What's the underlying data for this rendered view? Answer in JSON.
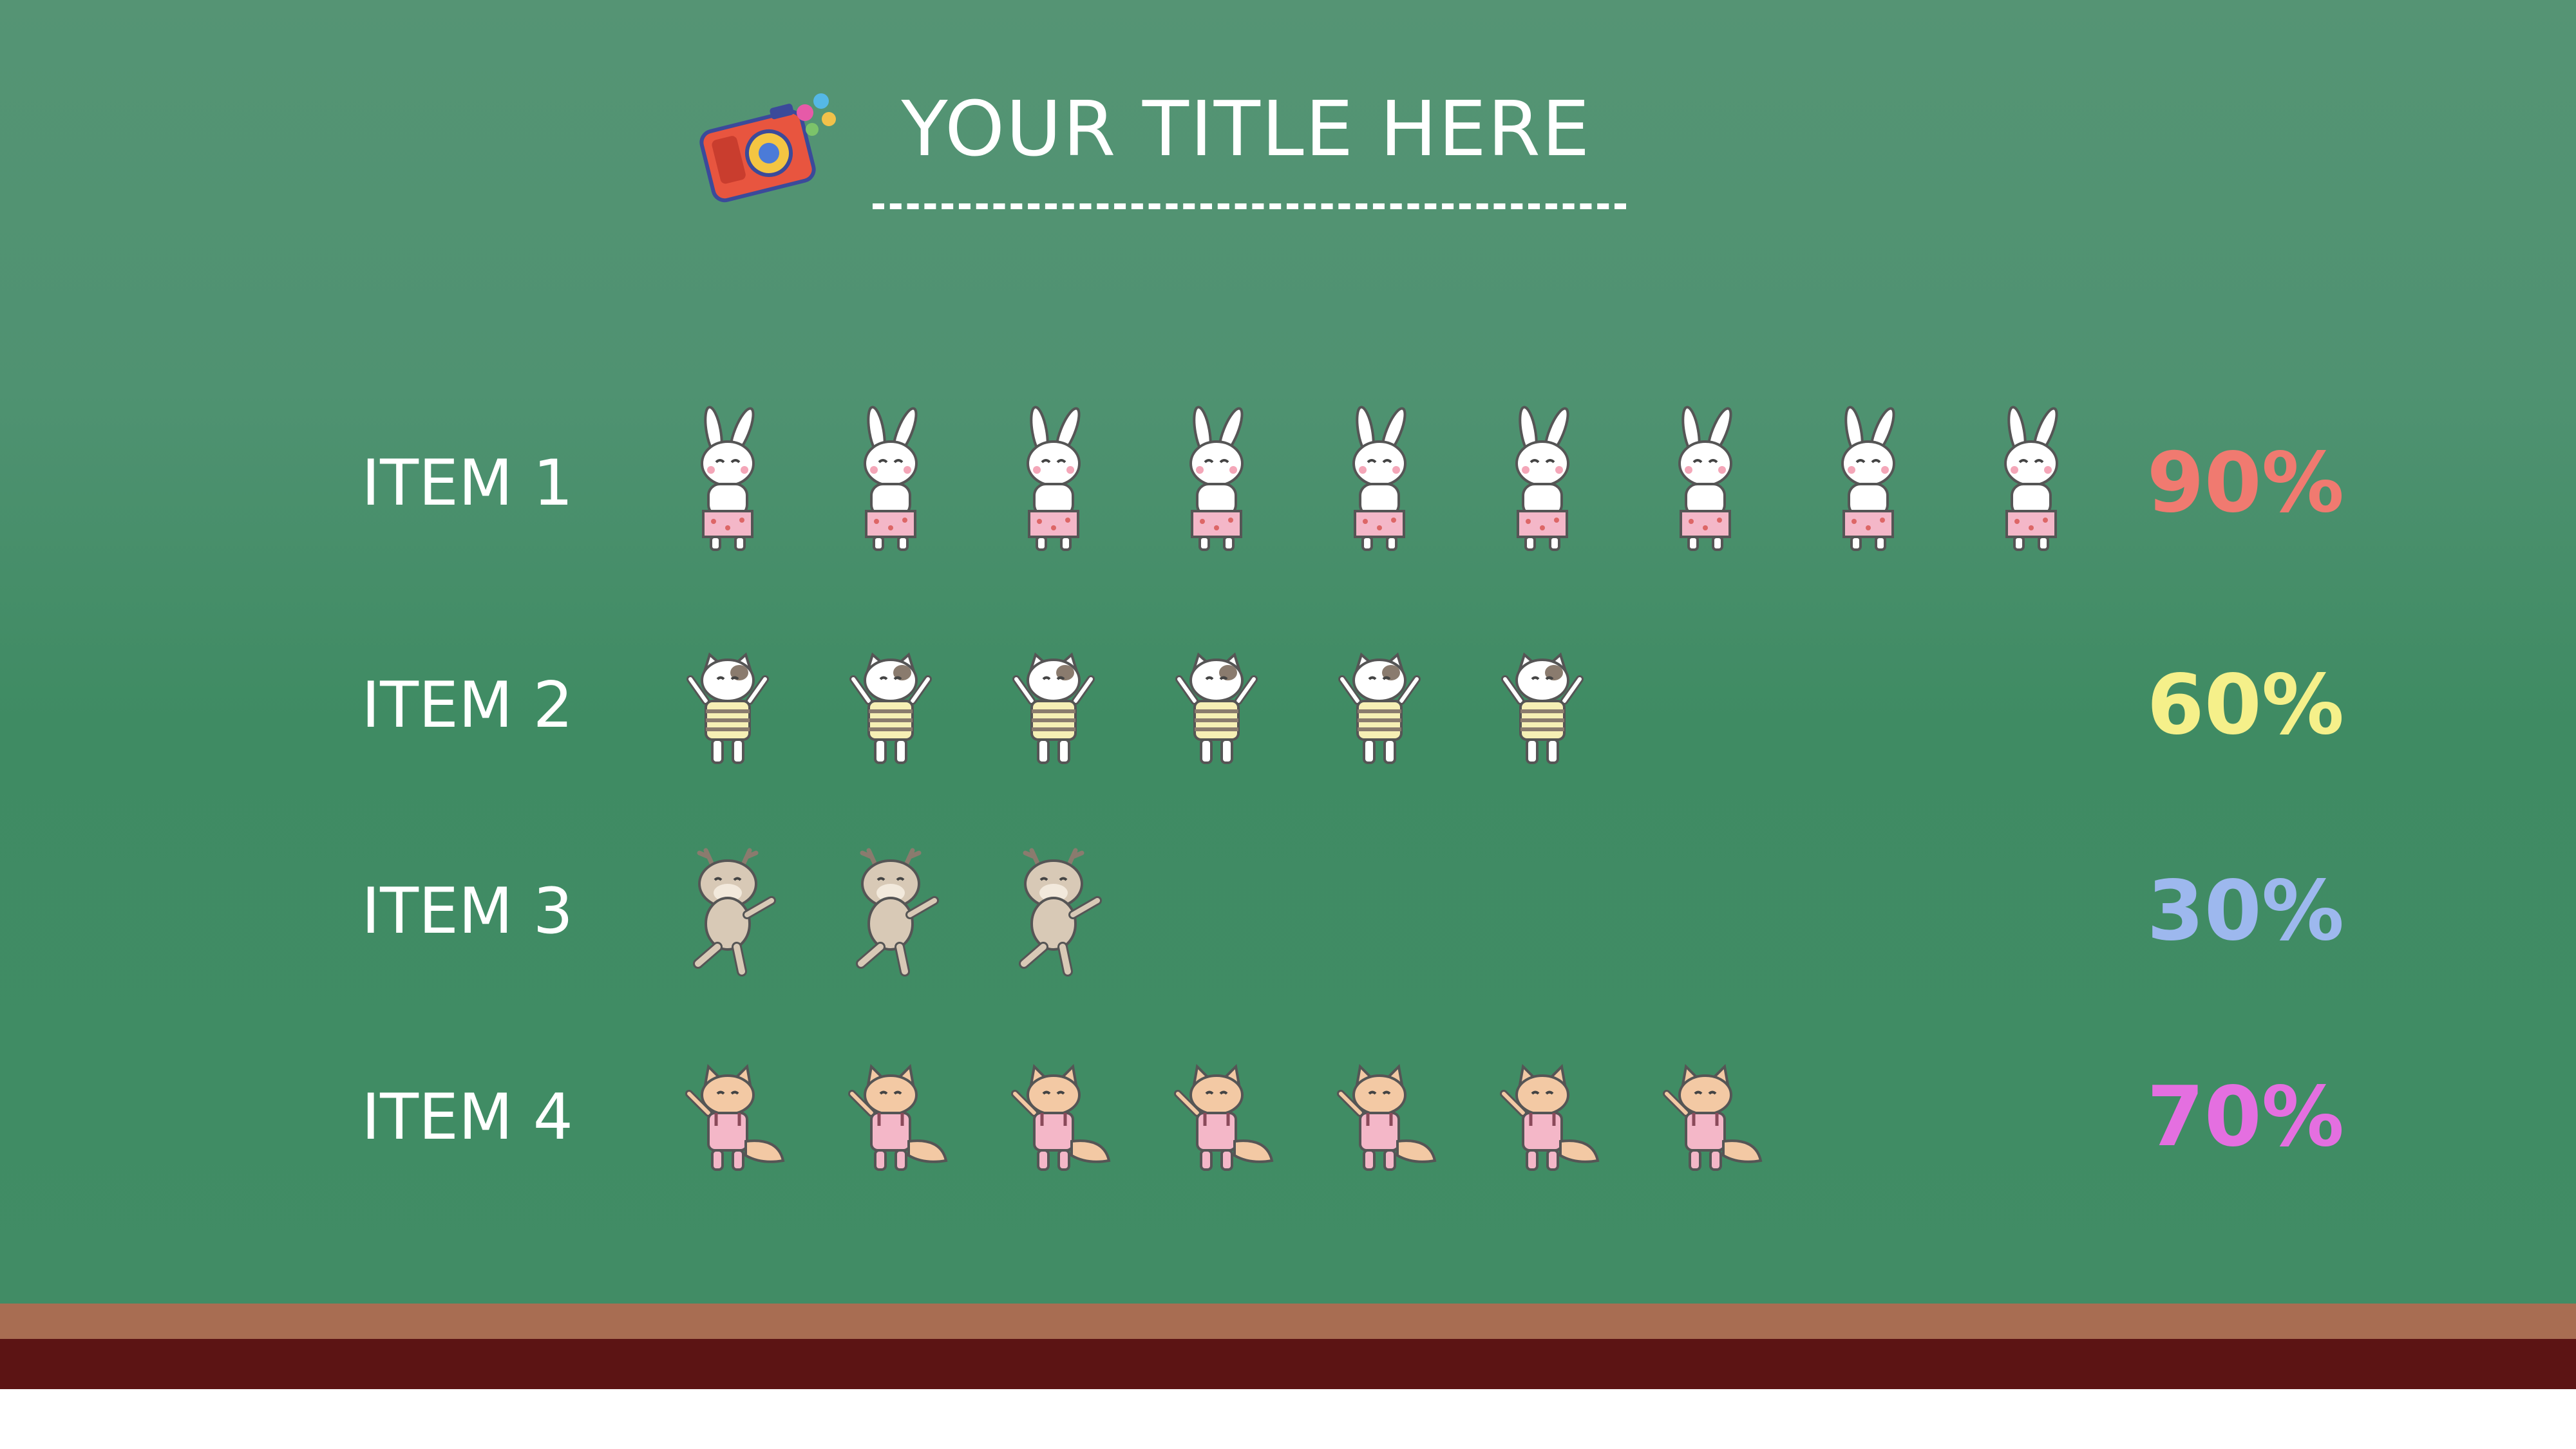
{
  "slide": {
    "title": "YOUR TITLE HERE"
  },
  "colors": {
    "board": "#4a9170",
    "ledge_top": "#a86d52",
    "ledge_bottom": "#5c1414"
  },
  "chart_data": {
    "type": "bar",
    "mark": "pictogram",
    "title": "YOUR TITLE HERE",
    "categories": [
      "ITEM 1",
      "ITEM 2",
      "ITEM 3",
      "ITEM 4"
    ],
    "values": [
      90,
      60,
      30,
      70
    ],
    "value_labels": [
      "90%",
      "60%",
      "30%",
      "70%"
    ],
    "unit": "%",
    "ylim": [
      0,
      100
    ],
    "icon_unit_value": 10,
    "icons": [
      "bunny-icon",
      "cat-icon",
      "deer-icon",
      "fox-icon"
    ],
    "label_colors": [
      "#f07a70",
      "#f5f08a",
      "#9db8ee",
      "#e46fe0"
    ],
    "grid": false,
    "legend": "none"
  }
}
